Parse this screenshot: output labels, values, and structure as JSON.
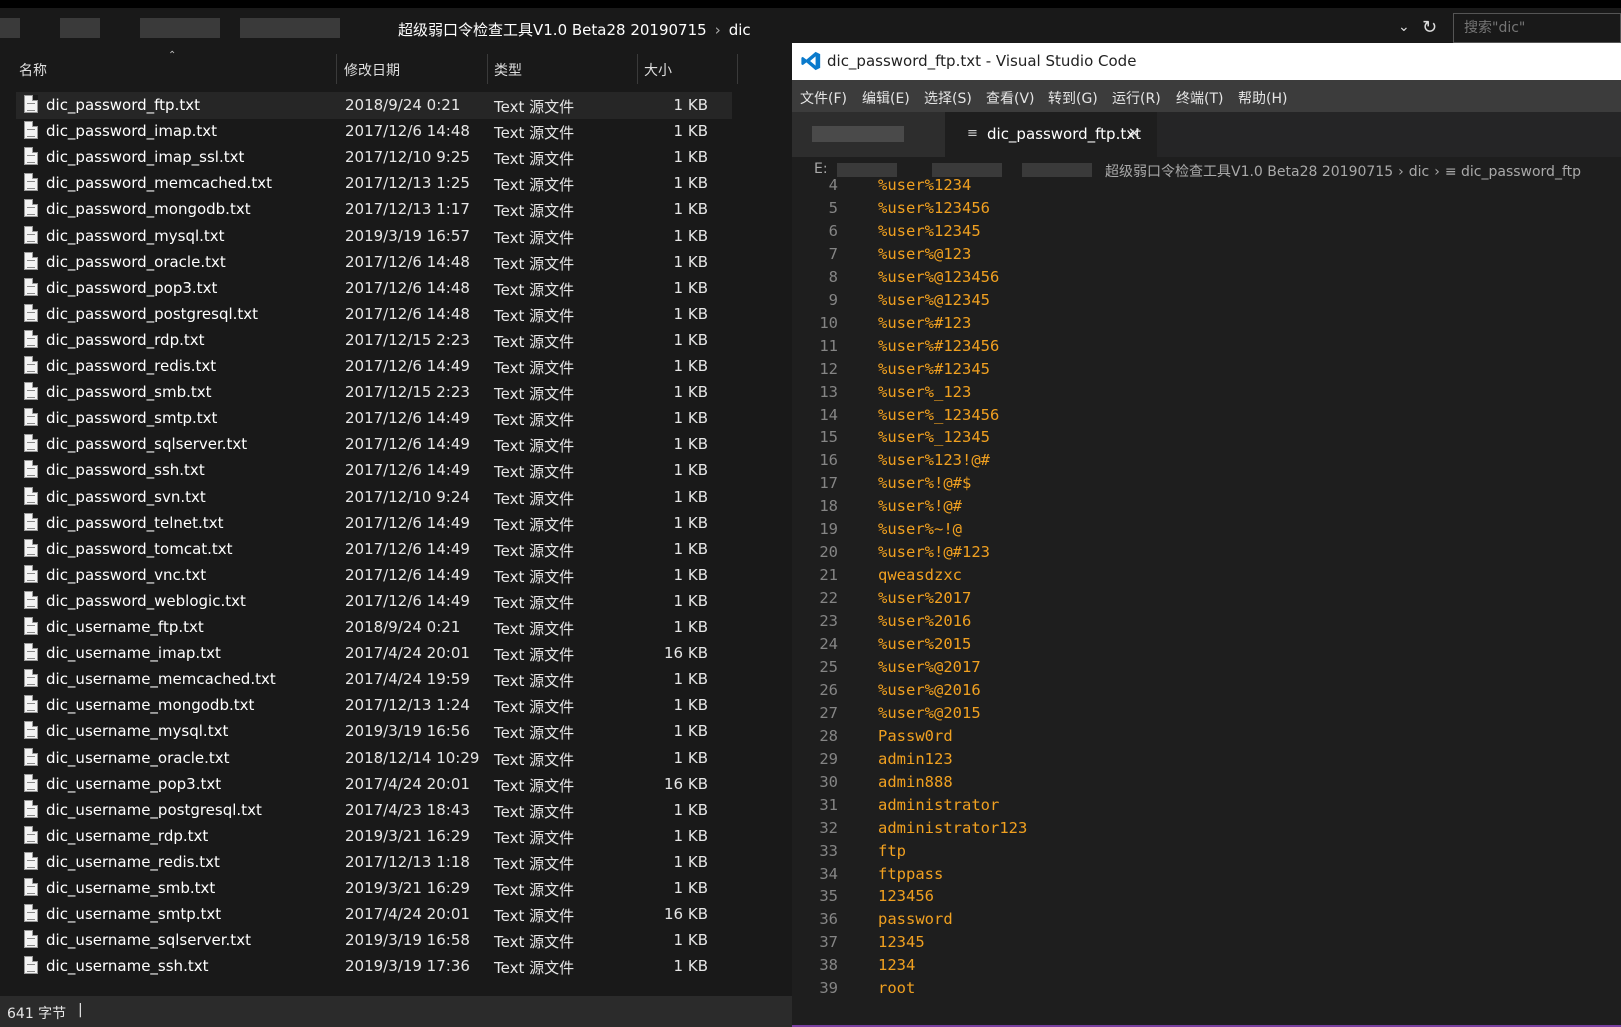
{
  "explorer": {
    "address": {
      "folder": "超级弱口令检查工具V1.0 Beta28 20190715",
      "subfolder": "dic",
      "separator": "›",
      "search_placeholder": "搜索\"dic\""
    },
    "columns": {
      "name": "名称",
      "date": "修改日期",
      "type": "类型",
      "size": "大小"
    },
    "files": [
      {
        "name": "dic_password_ftp.txt",
        "date": "2018/9/24 0:21",
        "type": "Text 源文件",
        "size": "1 KB",
        "selected": true
      },
      {
        "name": "dic_password_imap.txt",
        "date": "2017/12/6 14:48",
        "type": "Text 源文件",
        "size": "1 KB"
      },
      {
        "name": "dic_password_imap_ssl.txt",
        "date": "2017/12/10 9:25",
        "type": "Text 源文件",
        "size": "1 KB"
      },
      {
        "name": "dic_password_memcached.txt",
        "date": "2017/12/13 1:25",
        "type": "Text 源文件",
        "size": "1 KB"
      },
      {
        "name": "dic_password_mongodb.txt",
        "date": "2017/12/13 1:17",
        "type": "Text 源文件",
        "size": "1 KB"
      },
      {
        "name": "dic_password_mysql.txt",
        "date": "2019/3/19 16:57",
        "type": "Text 源文件",
        "size": "1 KB"
      },
      {
        "name": "dic_password_oracle.txt",
        "date": "2017/12/6 14:48",
        "type": "Text 源文件",
        "size": "1 KB"
      },
      {
        "name": "dic_password_pop3.txt",
        "date": "2017/12/6 14:48",
        "type": "Text 源文件",
        "size": "1 KB"
      },
      {
        "name": "dic_password_postgresql.txt",
        "date": "2017/12/6 14:48",
        "type": "Text 源文件",
        "size": "1 KB"
      },
      {
        "name": "dic_password_rdp.txt",
        "date": "2017/12/15 2:23",
        "type": "Text 源文件",
        "size": "1 KB"
      },
      {
        "name": "dic_password_redis.txt",
        "date": "2017/12/6 14:49",
        "type": "Text 源文件",
        "size": "1 KB"
      },
      {
        "name": "dic_password_smb.txt",
        "date": "2017/12/15 2:23",
        "type": "Text 源文件",
        "size": "1 KB"
      },
      {
        "name": "dic_password_smtp.txt",
        "date": "2017/12/6 14:49",
        "type": "Text 源文件",
        "size": "1 KB"
      },
      {
        "name": "dic_password_sqlserver.txt",
        "date": "2017/12/6 14:49",
        "type": "Text 源文件",
        "size": "1 KB"
      },
      {
        "name": "dic_password_ssh.txt",
        "date": "2017/12/6 14:49",
        "type": "Text 源文件",
        "size": "1 KB"
      },
      {
        "name": "dic_password_svn.txt",
        "date": "2017/12/10 9:24",
        "type": "Text 源文件",
        "size": "1 KB"
      },
      {
        "name": "dic_password_telnet.txt",
        "date": "2017/12/6 14:49",
        "type": "Text 源文件",
        "size": "1 KB"
      },
      {
        "name": "dic_password_tomcat.txt",
        "date": "2017/12/6 14:49",
        "type": "Text 源文件",
        "size": "1 KB"
      },
      {
        "name": "dic_password_vnc.txt",
        "date": "2017/12/6 14:49",
        "type": "Text 源文件",
        "size": "1 KB"
      },
      {
        "name": "dic_password_weblogic.txt",
        "date": "2017/12/6 14:49",
        "type": "Text 源文件",
        "size": "1 KB"
      },
      {
        "name": "dic_username_ftp.txt",
        "date": "2018/9/24 0:21",
        "type": "Text 源文件",
        "size": "1 KB"
      },
      {
        "name": "dic_username_imap.txt",
        "date": "2017/4/24 20:01",
        "type": "Text 源文件",
        "size": "16 KB"
      },
      {
        "name": "dic_username_memcached.txt",
        "date": "2017/4/24 19:59",
        "type": "Text 源文件",
        "size": "1 KB"
      },
      {
        "name": "dic_username_mongodb.txt",
        "date": "2017/12/13 1:24",
        "type": "Text 源文件",
        "size": "1 KB"
      },
      {
        "name": "dic_username_mysql.txt",
        "date": "2019/3/19 16:56",
        "type": "Text 源文件",
        "size": "1 KB"
      },
      {
        "name": "dic_username_oracle.txt",
        "date": "2018/12/14 10:29",
        "type": "Text 源文件",
        "size": "1 KB"
      },
      {
        "name": "dic_username_pop3.txt",
        "date": "2017/4/24 20:01",
        "type": "Text 源文件",
        "size": "16 KB"
      },
      {
        "name": "dic_username_postgresql.txt",
        "date": "2017/4/23 18:43",
        "type": "Text 源文件",
        "size": "1 KB"
      },
      {
        "name": "dic_username_rdp.txt",
        "date": "2019/3/21 16:29",
        "type": "Text 源文件",
        "size": "1 KB"
      },
      {
        "name": "dic_username_redis.txt",
        "date": "2017/12/13 1:18",
        "type": "Text 源文件",
        "size": "1 KB"
      },
      {
        "name": "dic_username_smb.txt",
        "date": "2019/3/21 16:29",
        "type": "Text 源文件",
        "size": "1 KB"
      },
      {
        "name": "dic_username_smtp.txt",
        "date": "2017/4/24 20:01",
        "type": "Text 源文件",
        "size": "16 KB"
      },
      {
        "name": "dic_username_sqlserver.txt",
        "date": "2019/3/19 16:58",
        "type": "Text 源文件",
        "size": "1 KB"
      },
      {
        "name": "dic_username_ssh.txt",
        "date": "2019/3/19 17:36",
        "type": "Text 源文件",
        "size": "1 KB"
      }
    ],
    "status": {
      "text": "641 字节",
      "caret": "|"
    }
  },
  "vscode": {
    "window_title": "dic_password_ftp.txt - Visual Studio Code",
    "menu": [
      "文件(F)",
      "编辑(E)",
      "选择(S)",
      "查看(V)",
      "转到(G)",
      "运行(R)",
      "终端(T)",
      "帮助(H)"
    ],
    "tab": {
      "label": "dic_password_ftp.txt",
      "close": "×",
      "icon": "≡"
    },
    "breadcrumb": {
      "drive": "E:",
      "folder": "超级弱口令检查工具V1.0 Beta28 20190715",
      "subfolder": "dic",
      "file": "dic_password_ftp",
      "sep": "›"
    },
    "lines": [
      {
        "n": "4",
        "text": "%user%1234"
      },
      {
        "n": "5",
        "text": "%user%123456"
      },
      {
        "n": "6",
        "text": "%user%12345"
      },
      {
        "n": "7",
        "text": "%user%@123"
      },
      {
        "n": "8",
        "text": "%user%@123456"
      },
      {
        "n": "9",
        "text": "%user%@12345"
      },
      {
        "n": "10",
        "text": "%user%#123"
      },
      {
        "n": "11",
        "text": "%user%#123456"
      },
      {
        "n": "12",
        "text": "%user%#12345"
      },
      {
        "n": "13",
        "text": "%user%_123"
      },
      {
        "n": "14",
        "text": "%user%_123456"
      },
      {
        "n": "15",
        "text": "%user%_12345"
      },
      {
        "n": "16",
        "text": "%user%123!@#"
      },
      {
        "n": "17",
        "text": "%user%!@#$"
      },
      {
        "n": "18",
        "text": "%user%!@#"
      },
      {
        "n": "19",
        "text": "%user%~!@"
      },
      {
        "n": "20",
        "text": "%user%!@#123"
      },
      {
        "n": "21",
        "text": "qweasdzxc"
      },
      {
        "n": "22",
        "text": "%user%2017"
      },
      {
        "n": "23",
        "text": "%user%2016"
      },
      {
        "n": "24",
        "text": "%user%2015"
      },
      {
        "n": "25",
        "text": "%user%@2017"
      },
      {
        "n": "26",
        "text": "%user%@2016"
      },
      {
        "n": "27",
        "text": "%user%@2015"
      },
      {
        "n": "28",
        "text": "Passw0rd"
      },
      {
        "n": "29",
        "text": "admin123"
      },
      {
        "n": "30",
        "text": "admin888"
      },
      {
        "n": "31",
        "text": "administrator"
      },
      {
        "n": "32",
        "text": "administrator123"
      },
      {
        "n": "33",
        "text": "ftp"
      },
      {
        "n": "34",
        "text": "ftppass"
      },
      {
        "n": "35",
        "text": "123456"
      },
      {
        "n": "36",
        "text": "password"
      },
      {
        "n": "37",
        "text": "12345"
      },
      {
        "n": "38",
        "text": "1234"
      },
      {
        "n": "39",
        "text": "root"
      }
    ]
  },
  "colors": {
    "code_text": "#f0a020",
    "line_number": "#858585",
    "vscode_logo": "#0a7acc"
  }
}
